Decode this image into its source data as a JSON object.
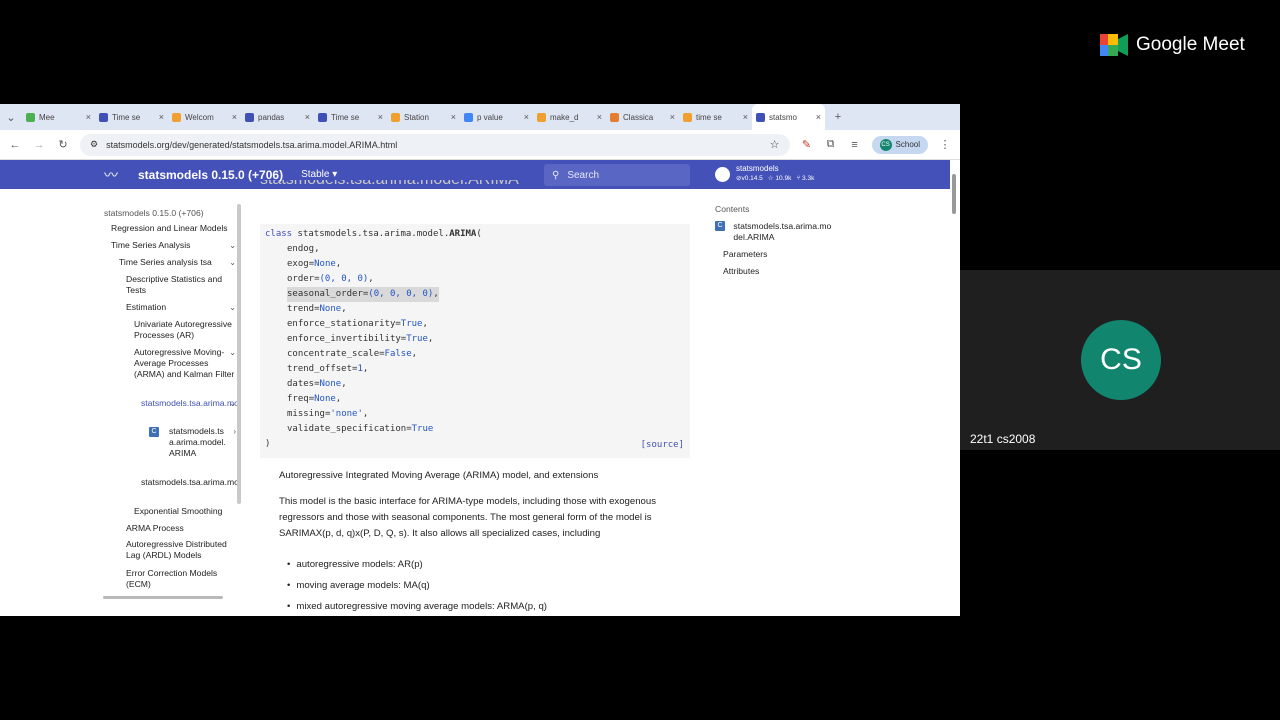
{
  "meet": {
    "brand": "Google Meet",
    "participant_initials": "CS",
    "participant_name": "22t1 cs2008"
  },
  "browser": {
    "tabs": [
      {
        "label": "Mee",
        "color": "#4caf50"
      },
      {
        "label": "Time se",
        "color": "#3f51b5"
      },
      {
        "label": "Welcom",
        "color": "#f0a030"
      },
      {
        "label": "pandas",
        "color": "#3f51b5"
      },
      {
        "label": "Time se",
        "color": "#3f51b5"
      },
      {
        "label": "Station",
        "color": "#f0a030"
      },
      {
        "label": "p value",
        "color": "#4285f4"
      },
      {
        "label": "make_d",
        "color": "#f0a030"
      },
      {
        "label": "Classica",
        "color": "#e57c2f"
      },
      {
        "label": "time se",
        "color": "#f0a030"
      },
      {
        "label": "statsmo",
        "color": "#3f51b5"
      }
    ],
    "url": "statsmodels.org/dev/generated/statsmodels.tsa.arima.model.ARIMA.html",
    "profile": "School",
    "profile_initials": "CS"
  },
  "site": {
    "title": "statsmodels 0.15.0 (+706)",
    "version_select": "Stable",
    "search_placeholder": "Search",
    "repo": {
      "name": "statsmodels",
      "version": "v0.14.5",
      "stars": "10.9k",
      "forks": "3.3k"
    },
    "ghost_heading": "statsmodels.tsa.arima.model.ARIMA"
  },
  "sidebar": {
    "items": [
      {
        "label": "statsmodels 0.15.0 (+706)"
      },
      {
        "label": "Regression and Linear Models"
      },
      {
        "label": "Time Series Analysis"
      },
      {
        "label": "Time Series analysis tsa"
      },
      {
        "label": "Descriptive Statistics and Tests"
      },
      {
        "label": "Estimation"
      },
      {
        "label": "Univariate Autoregressive Processes (AR)"
      },
      {
        "label": "Autoregressive Moving-Average Processes (ARMA) and Kalman Filter"
      },
      {
        "label": "statsmodels.tsa.arima.model.ARIMA"
      },
      {
        "label": "statsmodels.tsa.arima.model.ARIMA"
      },
      {
        "label": "statsmodels.tsa.arima.model.ARIMAResults"
      },
      {
        "label": "Exponential Smoothing"
      },
      {
        "label": "ARMA Process"
      },
      {
        "label": "Autoregressive Distributed Lag (ARDL) Models"
      },
      {
        "label": "Error Correction Models (ECM)"
      }
    ]
  },
  "signature": {
    "keyword": "class",
    "module": "statsmodels.tsa.arima.model.",
    "name": "ARIMA",
    "params": [
      "endog",
      "exog=None",
      "order=(0, 0, 0)",
      "seasonal_order=(0, 0, 0, 0)",
      "trend=None",
      "enforce_stationarity=True",
      "enforce_invertibility=True",
      "concentrate_scale=False",
      "trend_offset=1",
      "dates=None",
      "freq=None",
      "missing='none'",
      "validate_specification=True"
    ],
    "source_link": "[source]"
  },
  "doc": {
    "summary": "Autoregressive Integrated Moving Average (ARIMA) model, and extensions",
    "para1": "This model is the basic interface for ARIMA-type models, including those with exogenous regressors and those with seasonal components. The most general form of the model is SARIMAX(p, d, q)x(P, D, Q, s). It also allows all specialized cases, including",
    "bullets": [
      "autoregressive models: AR(p)",
      "moving average models: MA(q)",
      "mixed autoregressive moving average models: ARMA(p, q)"
    ]
  },
  "toc": {
    "heading": "Contents",
    "items": [
      "statsmodels.tsa.arima.model.ARIMA",
      "Parameters",
      "Attributes"
    ]
  }
}
